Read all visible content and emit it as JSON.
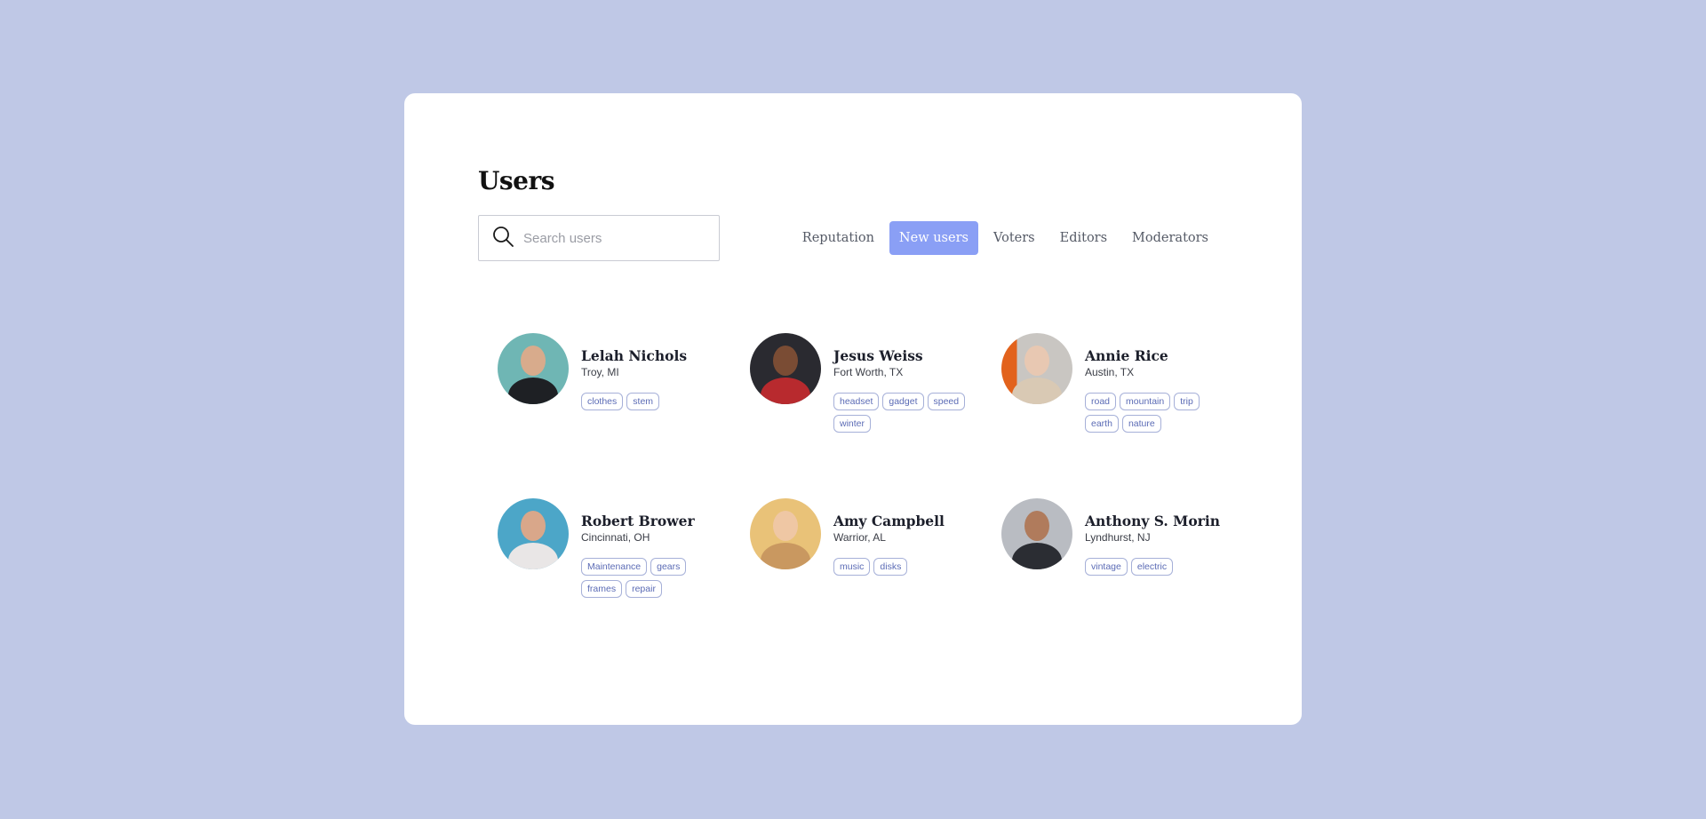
{
  "page": {
    "title": "Users"
  },
  "search": {
    "placeholder": "Search users",
    "value": ""
  },
  "tabs": [
    {
      "label": "Reputation",
      "active": false
    },
    {
      "label": "New users",
      "active": true
    },
    {
      "label": "Voters",
      "active": false
    },
    {
      "label": "Editors",
      "active": false
    },
    {
      "label": "Moderators",
      "active": false
    }
  ],
  "colors": {
    "background": "#bfc8e6",
    "accent": "#8a9ff5",
    "tag_text": "#5b6bb5",
    "tag_border": "#a6b0d8"
  },
  "users": [
    {
      "name": "Lelah Nichols",
      "location": "Troy, MI",
      "tags": [
        "clothes",
        "stem"
      ]
    },
    {
      "name": "Jesus Weiss",
      "location": "Fort Worth, TX",
      "tags": [
        "headset",
        "gadget",
        "speed",
        "winter"
      ]
    },
    {
      "name": "Annie Rice",
      "location": "Austin, TX",
      "tags": [
        "road",
        "mountain",
        "trip",
        "earth",
        "nature"
      ]
    },
    {
      "name": "Robert Brower",
      "location": "Cincinnati, OH",
      "tags": [
        "Maintenance",
        "gears",
        "frames",
        "repair"
      ]
    },
    {
      "name": "Amy Campbell",
      "location": "Warrior, AL",
      "tags": [
        "music",
        "disks"
      ]
    },
    {
      "name": "Anthony S. Morin",
      "location": "Lyndhurst, NJ",
      "tags": [
        "vintage",
        "electric"
      ]
    }
  ]
}
